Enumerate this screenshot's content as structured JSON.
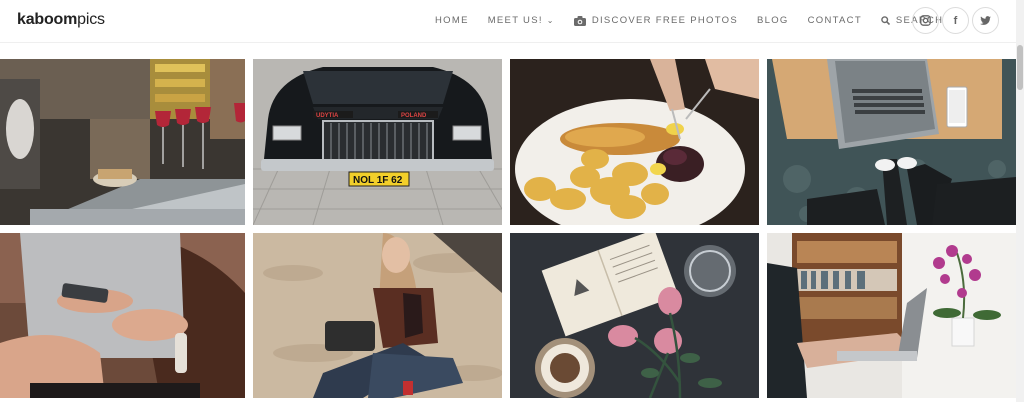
{
  "logo": {
    "bold": "kaboom",
    "rest": "pics"
  },
  "nav": {
    "home": "HOME",
    "meet_us": "MEET US!",
    "meet_us_chevron": "⌄",
    "discover": "DISCOVER FREE PHOTOS",
    "blog": "BLOG",
    "contact": "CONTACT",
    "search": "SEARCH"
  },
  "socials": [
    {
      "icon": "instagram-icon",
      "glyph": "◎"
    },
    {
      "icon": "facebook-icon",
      "glyph": "f"
    },
    {
      "icon": "twitter-icon",
      "glyph": "✦"
    }
  ],
  "photos": [
    {
      "subject": "bar counter with red drinks"
    },
    {
      "subject": "black vintage car",
      "plate": "NOL 1F 62",
      "badge_left": "UDYTIA",
      "badge_right": "POLAND"
    },
    {
      "subject": "plate of roasted potatoes and fish"
    },
    {
      "subject": "laptop and phone on wooden desk over rug"
    },
    {
      "subject": "woman holding smartphone"
    },
    {
      "subject": "blonde woman sitting on sand"
    },
    {
      "subject": "open book, coffee and pink roses"
    },
    {
      "subject": "person typing on laptop near orchid"
    }
  ],
  "colors": {
    "nav_text": "#6b6b6b",
    "logo_text": "#222222",
    "header_border": "#efefef"
  }
}
